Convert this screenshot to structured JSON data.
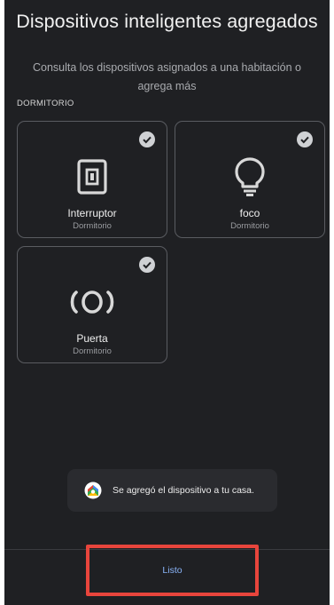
{
  "header": {
    "title": "Dispositivos inteligentes agregados",
    "subtitle": "Consulta los dispositivos asignados a una habitación o agrega más"
  },
  "section": {
    "label": "DORMITORIO"
  },
  "devices": [
    {
      "name": "Interruptor",
      "room": "Dormitorio",
      "icon": "switch-icon",
      "selected": true
    },
    {
      "name": "foco",
      "room": "Dormitorio",
      "icon": "lightbulb-icon",
      "selected": true
    },
    {
      "name": "Puerta",
      "room": "Dormitorio",
      "icon": "door-sensor-icon",
      "selected": true
    }
  ],
  "toast": {
    "text": "Se agregó el dispositivo a tu casa.",
    "icon": "google-home-icon"
  },
  "footer": {
    "done_label": "Listo"
  },
  "colors": {
    "background": "#1f2023",
    "card_border": "#5a5c61",
    "accent": "#8ab4f8",
    "highlight": "#e8453c"
  }
}
